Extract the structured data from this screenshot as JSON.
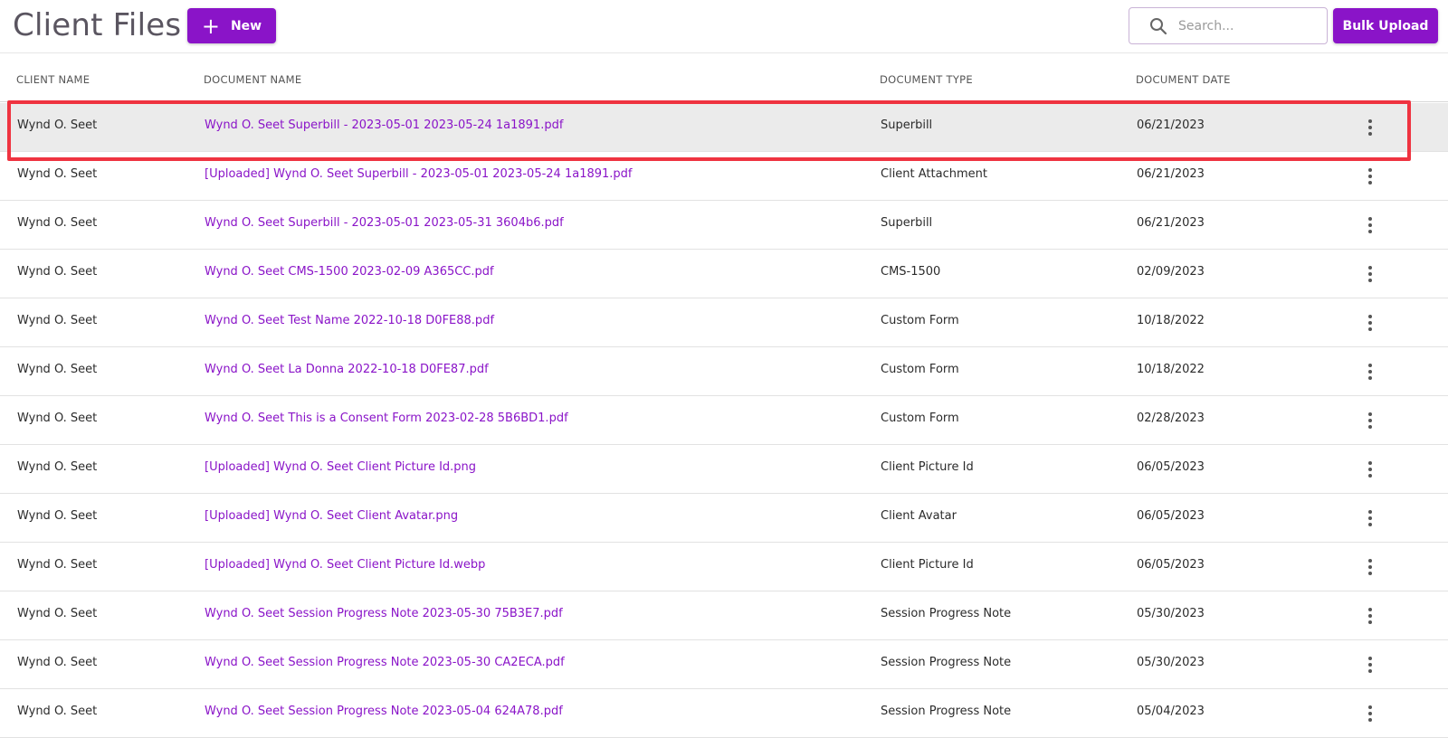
{
  "header": {
    "title": "Client Files",
    "new_button": {
      "icon": "plus-icon",
      "label": "New"
    },
    "search": {
      "icon": "search-icon",
      "placeholder": "Search..."
    },
    "bulk_upload_label": "Bulk Upload"
  },
  "table": {
    "columns": [
      "CLIENT NAME",
      "DOCUMENT NAME",
      "DOCUMENT TYPE",
      "DOCUMENT DATE"
    ],
    "rows": [
      {
        "client": "Wynd O. Seet",
        "document": "Wynd O. Seet Superbill - 2023-05-01 2023-05-24 1a1891.pdf",
        "type": "Superbill",
        "date": "06/21/2023"
      },
      {
        "client": "Wynd O. Seet",
        "document": "[Uploaded] Wynd O. Seet Superbill - 2023-05-01 2023-05-24 1a1891.pdf",
        "type": "Client Attachment",
        "date": "06/21/2023"
      },
      {
        "client": "Wynd O. Seet",
        "document": "Wynd O. Seet Superbill - 2023-05-01 2023-05-31 3604b6.pdf",
        "type": "Superbill",
        "date": "06/21/2023"
      },
      {
        "client": "Wynd O. Seet",
        "document": "Wynd O. Seet CMS-1500 2023-02-09 A365CC.pdf",
        "type": "CMS-1500",
        "date": "02/09/2023"
      },
      {
        "client": "Wynd O. Seet",
        "document": "Wynd O. Seet Test Name 2022-10-18 D0FE88.pdf",
        "type": "Custom Form",
        "date": "10/18/2022"
      },
      {
        "client": "Wynd O. Seet",
        "document": "Wynd O. Seet La Donna 2022-10-18 D0FE87.pdf",
        "type": "Custom Form",
        "date": "10/18/2022"
      },
      {
        "client": "Wynd O. Seet",
        "document": "Wynd O. Seet This is a Consent Form 2023-02-28 5B6BD1.pdf",
        "type": "Custom Form",
        "date": "02/28/2023"
      },
      {
        "client": "Wynd O. Seet",
        "document": "[Uploaded] Wynd O. Seet Client Picture Id.png",
        "type": "Client Picture Id",
        "date": "06/05/2023"
      },
      {
        "client": "Wynd O. Seet",
        "document": "[Uploaded] Wynd O. Seet Client Avatar.png",
        "type": "Client Avatar",
        "date": "06/05/2023"
      },
      {
        "client": "Wynd O. Seet",
        "document": "[Uploaded] Wynd O. Seet Client Picture Id.webp",
        "type": "Client Picture Id",
        "date": "06/05/2023"
      },
      {
        "client": "Wynd O. Seet",
        "document": "Wynd O. Seet Session Progress Note 2023-05-30 75B3E7.pdf",
        "type": "Session Progress Note",
        "date": "05/30/2023"
      },
      {
        "client": "Wynd O. Seet",
        "document": "Wynd O. Seet Session Progress Note 2023-05-30 CA2ECA.pdf",
        "type": "Session Progress Note",
        "date": "05/30/2023"
      },
      {
        "client": "Wynd O. Seet",
        "document": "Wynd O. Seet Session Progress Note 2023-05-04 624A78.pdf",
        "type": "Session Progress Note",
        "date": "05/04/2023"
      }
    ],
    "row_action_icon": "more-vertical-icon"
  },
  "colors": {
    "accent": "#8a14c8",
    "highlight_border": "#ef3340",
    "highlight_row": "#ebebeb"
  }
}
